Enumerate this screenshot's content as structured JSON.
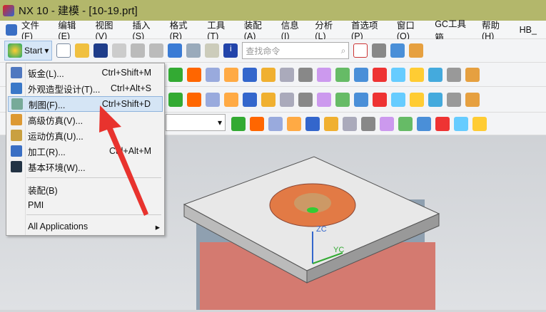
{
  "window": {
    "title": "NX 10 - 建模 - [10-19.prt]",
    "title_bar_color": "#b3b76b"
  },
  "menubar": {
    "items": [
      "文件(F)",
      "编辑(E)",
      "视图(V)",
      "插入(S)",
      "格式(R)",
      "工具(T)",
      "装配(A)",
      "信息(I)",
      "分析(L)",
      "首选项(P)",
      "窗口(O)",
      "GC工具箱",
      "帮助(H)",
      "HB_"
    ]
  },
  "toolbar": {
    "start_label": "Start",
    "search_placeholder": "查找命令"
  },
  "start_menu": {
    "items": [
      {
        "label": "钣金(L)...",
        "shortcut": "Ctrl+Shift+M",
        "icon": "sheet-metal-icon"
      },
      {
        "label": "外观造型设计(T)...",
        "shortcut": "Ctrl+Alt+S",
        "icon": "shape-studio-icon"
      },
      {
        "label": "制图(F)...",
        "shortcut": "Ctrl+Shift+D",
        "icon": "drafting-icon",
        "highlighted": true
      },
      {
        "label": "高级仿真(V)...",
        "shortcut": "",
        "icon": "advanced-simulation-icon"
      },
      {
        "label": "运动仿真(U)...",
        "shortcut": "",
        "icon": "motion-simulation-icon"
      },
      {
        "label": "加工(R)...",
        "shortcut": "Ctrl+Alt+M",
        "icon": "manufacturing-icon"
      },
      {
        "label": "基本环境(W)...",
        "shortcut": "",
        "icon": "gateway-icon"
      },
      {
        "label": "装配(B)",
        "shortcut": ""
      },
      {
        "label": "PMI",
        "shortcut": ""
      },
      {
        "label": "All Applications",
        "shortcut": "",
        "submenu": true
      }
    ]
  },
  "viewport": {
    "axis_z": "ZC",
    "axis_y": "YC"
  },
  "annotation": {
    "arrow_color": "#e8332e"
  }
}
